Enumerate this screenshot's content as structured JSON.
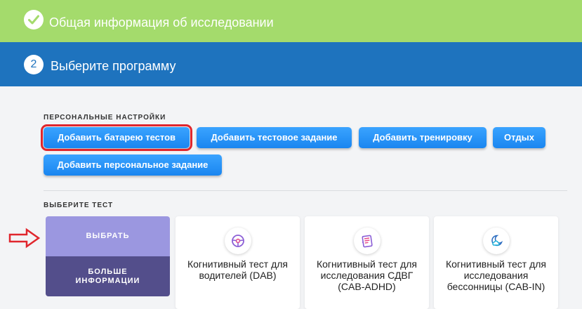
{
  "steps": {
    "step1": {
      "title": "Общая информация об исследовании",
      "status_icon": "check-icon"
    },
    "step2": {
      "number": "2",
      "title": "Выберите программу"
    }
  },
  "personal": {
    "label": "ПЕРСОНАЛЬНЫЕ НАСТРОЙКИ",
    "buttons": [
      "Добавить батарею тестов",
      "Добавить тестовое задание",
      "Добавить тренировку",
      "Отдых",
      "Добавить персональное задание"
    ]
  },
  "tests": {
    "label": "ВЫБЕРИТЕ ТЕСТ",
    "overlay": {
      "select": "ВЫБРАТЬ",
      "more_line1": "БОЛЬШЕ",
      "more_line2": "ИНФОРМАЦИИ"
    },
    "cards": [
      {
        "icon": "steering-wheel-icon",
        "title": [
          "Когнитивный тест для",
          "водителей (DAB)"
        ]
      },
      {
        "icon": "notebook-icon",
        "title": [
          "Когнитивный тест для",
          "исследования СДВГ",
          "(CAB-ADHD)"
        ]
      },
      {
        "icon": "moon-cloud-icon",
        "title": [
          "Когнитивный тест для",
          "исследования",
          "бессонницы (CAB-IN)"
        ]
      }
    ]
  },
  "colors": {
    "step_done": "#a4db6c",
    "step_active": "#1e73be",
    "button": "#1a86f0",
    "highlight": "#e0262d",
    "overlay_top": "#9b97e0",
    "overlay_bottom": "#534e8b"
  }
}
